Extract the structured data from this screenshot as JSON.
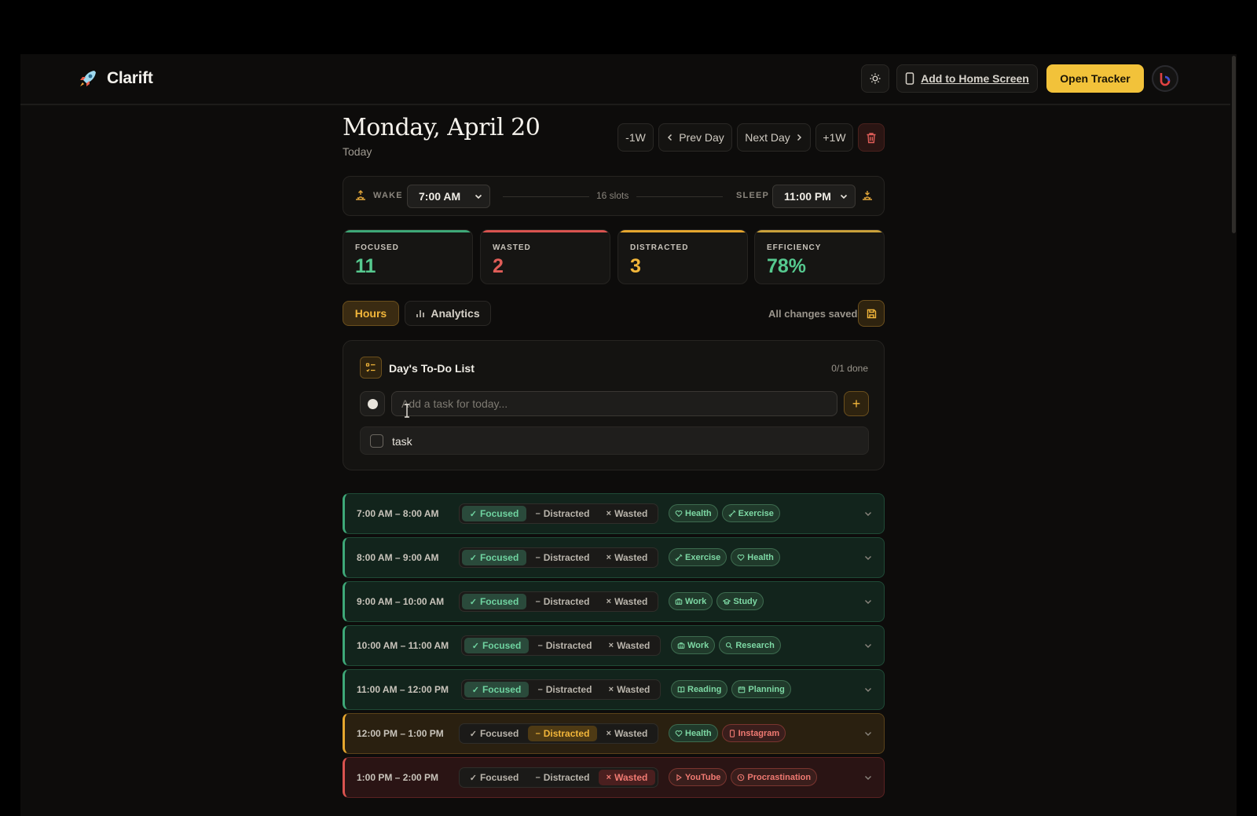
{
  "app": {
    "name": "Clarift"
  },
  "header": {
    "theme_icon": "sun-icon",
    "add_home_label": "Add to Home Screen",
    "open_tracker_label": "Open Tracker"
  },
  "day": {
    "title": "Monday, April 20",
    "subtitle": "Today"
  },
  "nav": {
    "minus_week": "-1W",
    "prev_day": "Prev Day",
    "next_day": "Next Day",
    "plus_week": "+1W"
  },
  "schedule": {
    "wake_label": "WAKE",
    "wake_value": "7:00 AM",
    "slots_text": "16 slots",
    "sleep_label": "SLEEP",
    "sleep_value": "11:00 PM"
  },
  "stats": [
    {
      "label": "FOCUSED",
      "value": "11",
      "color": "#56c98f"
    },
    {
      "label": "WASTED",
      "value": "2",
      "color": "#e05d58"
    },
    {
      "label": "DISTRACTED",
      "value": "3",
      "color": "#f2b63a"
    },
    {
      "label": "EFFICIENCY",
      "value": "78%",
      "color": "#56c98f"
    }
  ],
  "tabs": {
    "hours": "Hours",
    "analytics": "Analytics"
  },
  "saved_status": "All changes saved",
  "todo": {
    "title": "Day's To-Do List",
    "count": "0/1 done",
    "placeholder": "Add a task for today...",
    "add_label": "+",
    "items": [
      {
        "text": "task",
        "done": false
      }
    ]
  },
  "status_labels": {
    "focused": "Focused",
    "distracted": "Distracted",
    "wasted": "Wasted"
  },
  "slots": [
    {
      "time": "7:00 AM – 8:00 AM",
      "status": "focused",
      "tags": [
        {
          "label": "Health",
          "icon": "heart-icon",
          "tone": "green"
        },
        {
          "label": "Exercise",
          "icon": "dumbbell-icon",
          "tone": "green"
        }
      ]
    },
    {
      "time": "8:00 AM – 9:00 AM",
      "status": "focused",
      "tags": [
        {
          "label": "Exercise",
          "icon": "dumbbell-icon",
          "tone": "green"
        },
        {
          "label": "Health",
          "icon": "heart-icon",
          "tone": "green"
        }
      ]
    },
    {
      "time": "9:00 AM – 10:00 AM",
      "status": "focused",
      "tags": [
        {
          "label": "Work",
          "icon": "briefcase-icon",
          "tone": "green"
        },
        {
          "label": "Study",
          "icon": "graduation-icon",
          "tone": "green"
        }
      ]
    },
    {
      "time": "10:00 AM – 11:00 AM",
      "status": "focused",
      "tags": [
        {
          "label": "Work",
          "icon": "briefcase-icon",
          "tone": "green"
        },
        {
          "label": "Research",
          "icon": "search-icon",
          "tone": "green"
        }
      ]
    },
    {
      "time": "11:00 AM – 12:00 PM",
      "status": "focused",
      "tags": [
        {
          "label": "Reading",
          "icon": "book-icon",
          "tone": "green"
        },
        {
          "label": "Planning",
          "icon": "calendar-icon",
          "tone": "green"
        }
      ]
    },
    {
      "time": "12:00 PM – 1:00 PM",
      "status": "distracted",
      "tags": [
        {
          "label": "Health",
          "icon": "heart-icon",
          "tone": "green"
        },
        {
          "label": "Instagram",
          "icon": "phone-icon",
          "tone": "red"
        }
      ]
    },
    {
      "time": "1:00 PM – 2:00 PM",
      "status": "wasted",
      "tags": [
        {
          "label": "YouTube",
          "icon": "play-icon",
          "tone": "red"
        },
        {
          "label": "Procrastination",
          "icon": "clock-icon",
          "tone": "red"
        }
      ]
    }
  ]
}
